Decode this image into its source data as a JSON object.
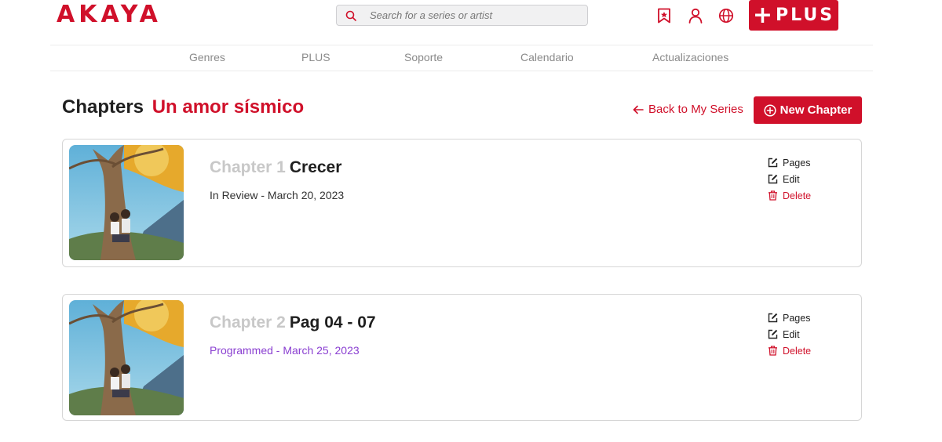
{
  "header": {
    "logo": "AKAYA",
    "search_placeholder": "Search for a series or artist",
    "plus_label": "PLUS",
    "plus_sign": "+"
  },
  "icons": {
    "search": "search-icon",
    "bookmark": "bookmark-icon",
    "user": "user-icon",
    "globe": "globe-icon",
    "back": "arrow-left-icon",
    "new": "plus-circle-icon",
    "pages": "edit-square-icon",
    "edit": "edit-square-icon",
    "delete": "trash-icon"
  },
  "nav": {
    "items": [
      "Genres",
      "PLUS",
      "Soporte",
      "Calendario",
      "Actualizaciones"
    ]
  },
  "page": {
    "title_prefix": "Chapters",
    "series_name": "Un amor sísmico",
    "back_label": "Back to My Series",
    "new_chapter_label": "New Chapter"
  },
  "chapters": [
    {
      "number": "Chapter 1",
      "name": "Crecer",
      "status": "In Review - March 20, 2023",
      "status_color": "#333333",
      "actions": {
        "pages": "Pages",
        "edit": "Edit",
        "delete": "Delete"
      }
    },
    {
      "number": "Chapter 2",
      "name": "Pag 04 - 07",
      "status": "Programmed - March 25, 2023",
      "status_color": "#8a3fd1",
      "actions": {
        "pages": "Pages",
        "edit": "Edit",
        "delete": "Delete"
      }
    }
  ],
  "colors": {
    "brand": "#d0102a",
    "muted": "#8a8a8a",
    "programmed": "#8a3fd1"
  }
}
